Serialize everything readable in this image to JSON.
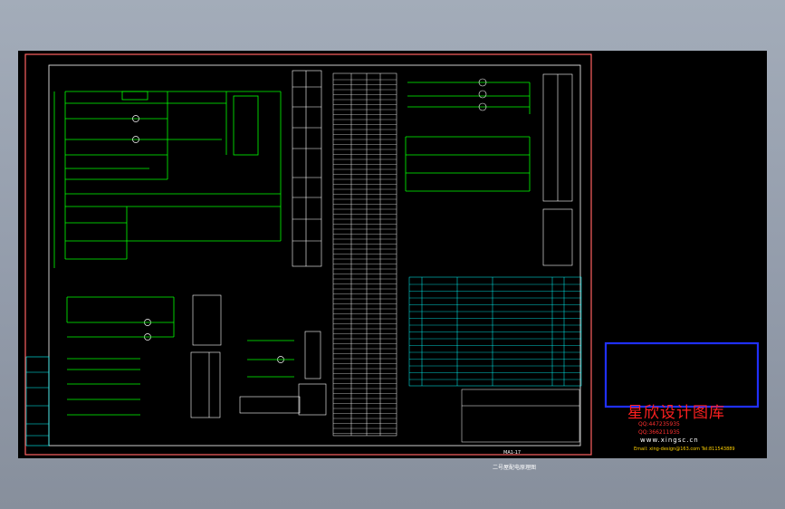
{
  "watermark": {
    "title": "星欣设计图库",
    "qq1": "QQ:447235935",
    "qq2": "QQ:366211935",
    "website": "www.xingsc.cn",
    "email": "Email: xing-design@163.com  Tel:811543889"
  },
  "title_block": {
    "drawing_code": "MA1-17",
    "drawing_title": "二号屋配电原理图"
  },
  "colors": {
    "sheet_background": "#000000",
    "outer_frame": "#ff6060",
    "inner_frame": "#ffffff",
    "circuit_lines": "#00ff00",
    "labels": "#ff0000",
    "table_lines": "#00ffff",
    "watermark_border": "#2030ff"
  }
}
